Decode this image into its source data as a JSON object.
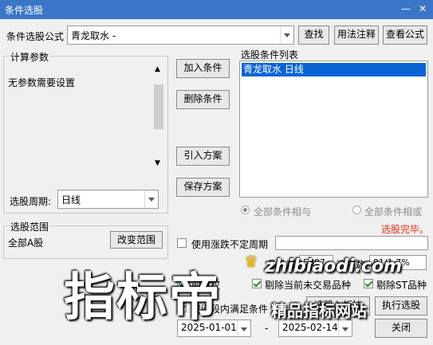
{
  "window": {
    "title": "条件选股"
  },
  "formula": {
    "label": "条件选股公式",
    "value": "青龙取水  -",
    "find_button": "查找",
    "usage_button": "用法注释",
    "view_button": "查看公式"
  },
  "params": {
    "legend": "计算参数",
    "message": "无参数需要设置"
  },
  "period": {
    "label": "选股周期:",
    "value": "日线"
  },
  "actions": {
    "add": "加入条件",
    "delete": "删除条件",
    "import": "引入方案",
    "save": "保存方案"
  },
  "conditions": {
    "legend": "选股条件列表",
    "items": [
      "青龙取水  日线"
    ]
  },
  "logic": {
    "and_label": "全部条件相与",
    "or_label": "全部条件相或"
  },
  "status": {
    "text": "选股完毕。",
    "color": "#e8321e"
  },
  "scope": {
    "legend": "选股范围",
    "value": "全部A股",
    "change_button": "改变范围"
  },
  "uncertain_period": {
    "label": "使用涨跌不定周期"
  },
  "stats": {
    "count_label": "品种数",
    "count_value": "5397",
    "selected_label": "选中数",
    "selected_value": "91/1.7%"
  },
  "options": {
    "pre_restore": "前复权",
    "exclude_unlisted": "剔除当前未交易品种",
    "exclude_st": "剔除ST品种",
    "time_condition": "时间段内满足条件"
  },
  "dates": {
    "start": "2025-01-01",
    "separator": "-",
    "end": "2025-02-14"
  },
  "bottom_buttons": {
    "select_to_block": "选股入板块",
    "execute": "执行选股",
    "close": "关闭"
  },
  "watermark": {
    "big": "指标帝",
    "url": "zhibiaodi.com",
    "slogan": "精品指标网站"
  }
}
